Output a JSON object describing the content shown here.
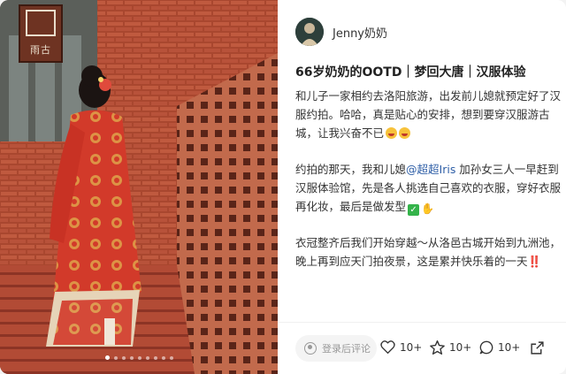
{
  "author": {
    "name": "Jenny奶奶",
    "avatar": "avatar-photo"
  },
  "post": {
    "title": "66岁奶奶的OOTD｜梦回大唐｜汉服体验",
    "paragraph1": "和儿子一家相约去洛阳旅游，出发前儿媳就预定好了汉服约拍。哈哈，真是贴心的安排，想到要穿汉服游古城，让我兴奋不已",
    "paragraph2_before": "约拍的那天，我和儿媳",
    "mention": "@超超Iris",
    "paragraph2_after": " 加孙女三人一早赶到汉服体验馆，先是各人挑选自己喜欢的衣服，穿好衣服再化妆，最后是做发型",
    "paragraph3": "衣冠整齐后我们开始穿越～从洛邑古城开始到九洲池，晚上再到应天门拍夜景，这是累并快乐着的一天‼️"
  },
  "image": {
    "sign_text": "雨古",
    "carousel_total": 9,
    "carousel_active": 0
  },
  "actions": {
    "comment_placeholder": "登录后评论",
    "like_count": "10+",
    "favorite_count": "10+",
    "comment_count": "10+"
  },
  "colors": {
    "brick": "#b3513b",
    "robe": "#d23a2a",
    "mention": "#2f5fa7",
    "check_emoji": "#34b34a"
  }
}
